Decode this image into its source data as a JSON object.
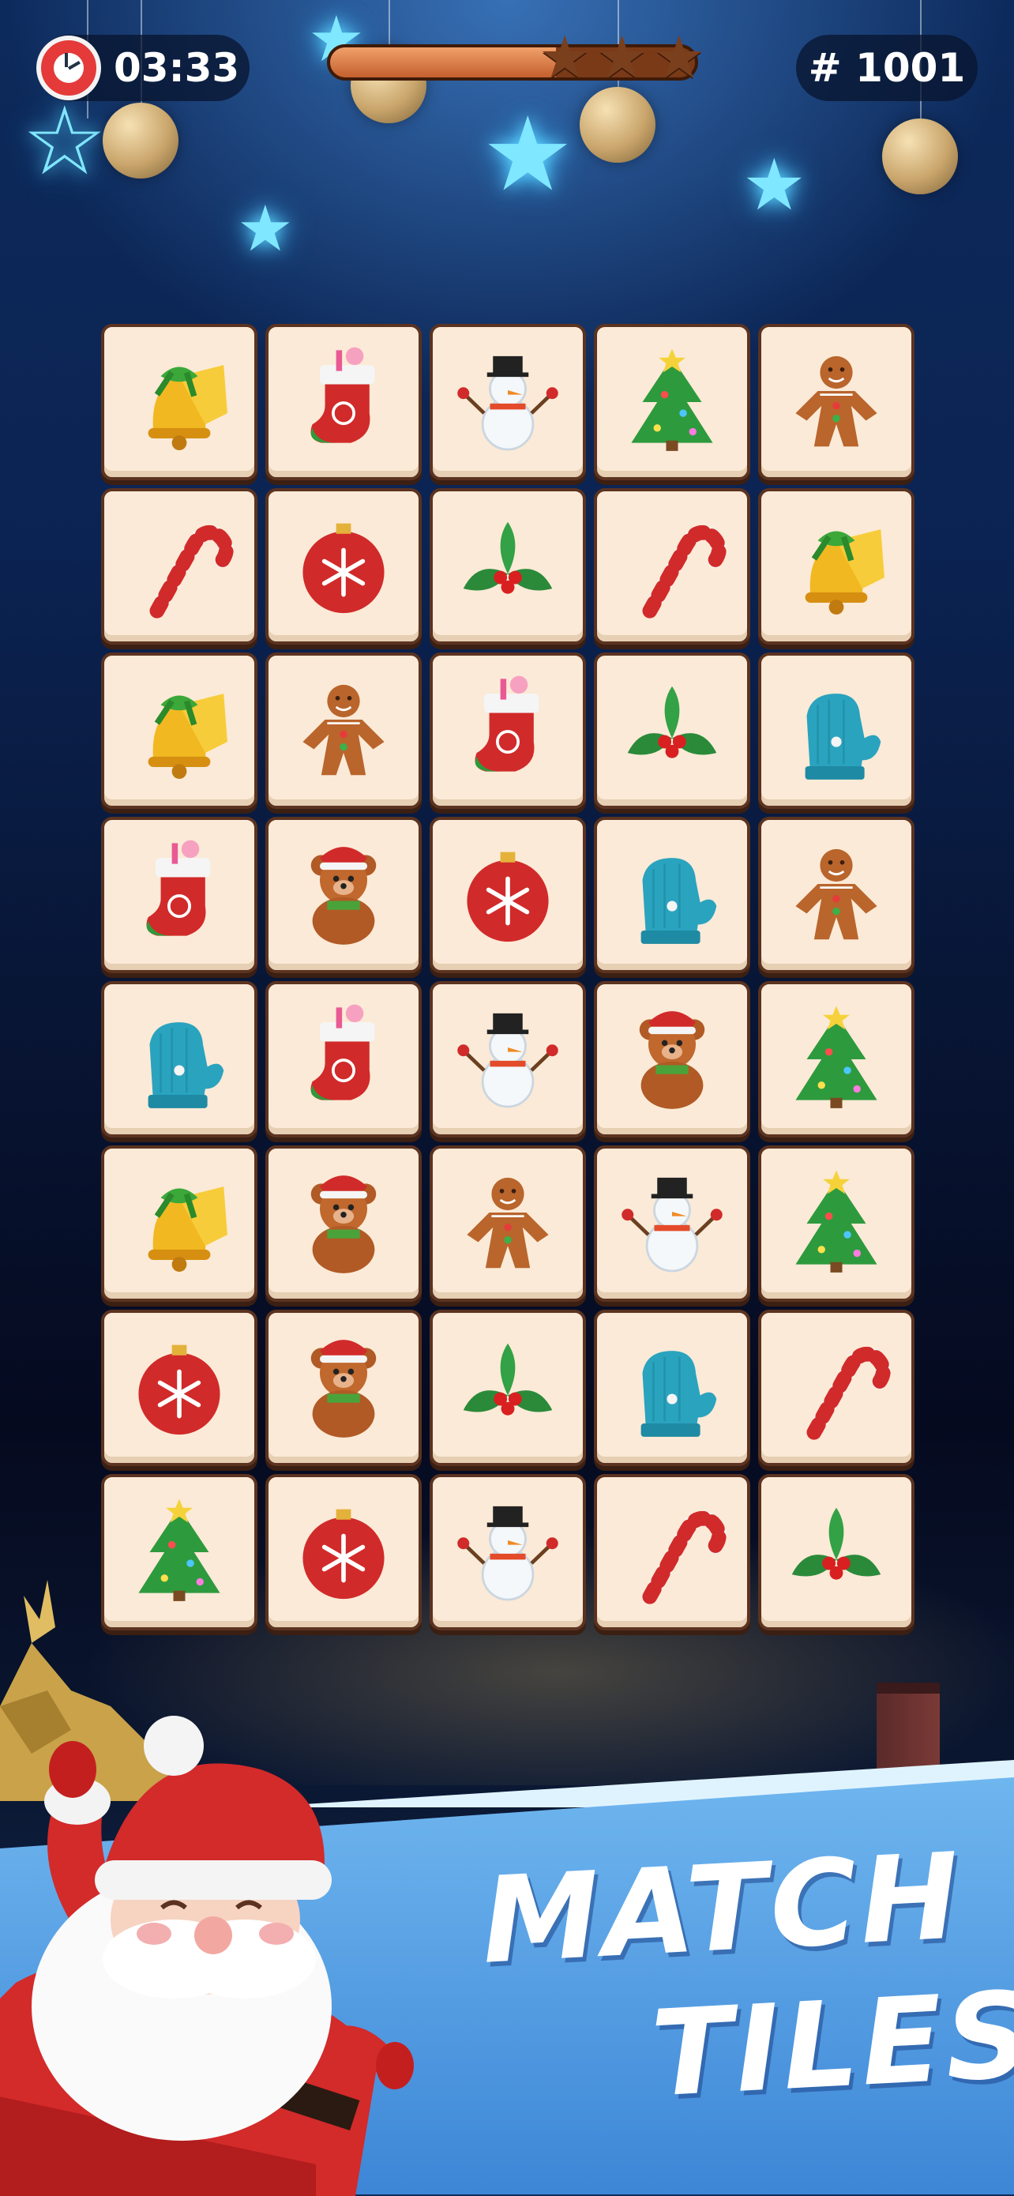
{
  "hud": {
    "timer": "03:33",
    "level": "# 1001",
    "progress_fraction": 0.62,
    "stars_total": 3
  },
  "board": {
    "columns": 5,
    "rows": [
      [
        "bell",
        "stocking",
        "snowman",
        "tree",
        "gingerbread"
      ],
      [
        "candy-cane",
        "ornament",
        "holly",
        "candy-cane",
        "bell"
      ],
      [
        "bell",
        "gingerbread",
        "stocking",
        "holly",
        "mitten"
      ],
      [
        "stocking",
        "teddy-bear",
        "ornament",
        "mitten",
        "gingerbread"
      ],
      [
        "mitten",
        "stocking",
        "snowman",
        "teddy-bear",
        "tree"
      ],
      [
        "bell",
        "teddy-bear",
        "gingerbread",
        "snowman",
        "tree"
      ],
      [
        "ornament",
        "teddy-bear",
        "holly",
        "mitten",
        "candy-cane"
      ],
      [
        "tree",
        "ornament",
        "snowman",
        "candy-cane",
        "holly"
      ]
    ]
  },
  "banner": {
    "line1": "MATCH",
    "line2": "TILES!"
  },
  "colors": {
    "tile_face": "#fbead7",
    "tile_border": "#5b3320",
    "banner_blue": "#4f9ae2"
  }
}
